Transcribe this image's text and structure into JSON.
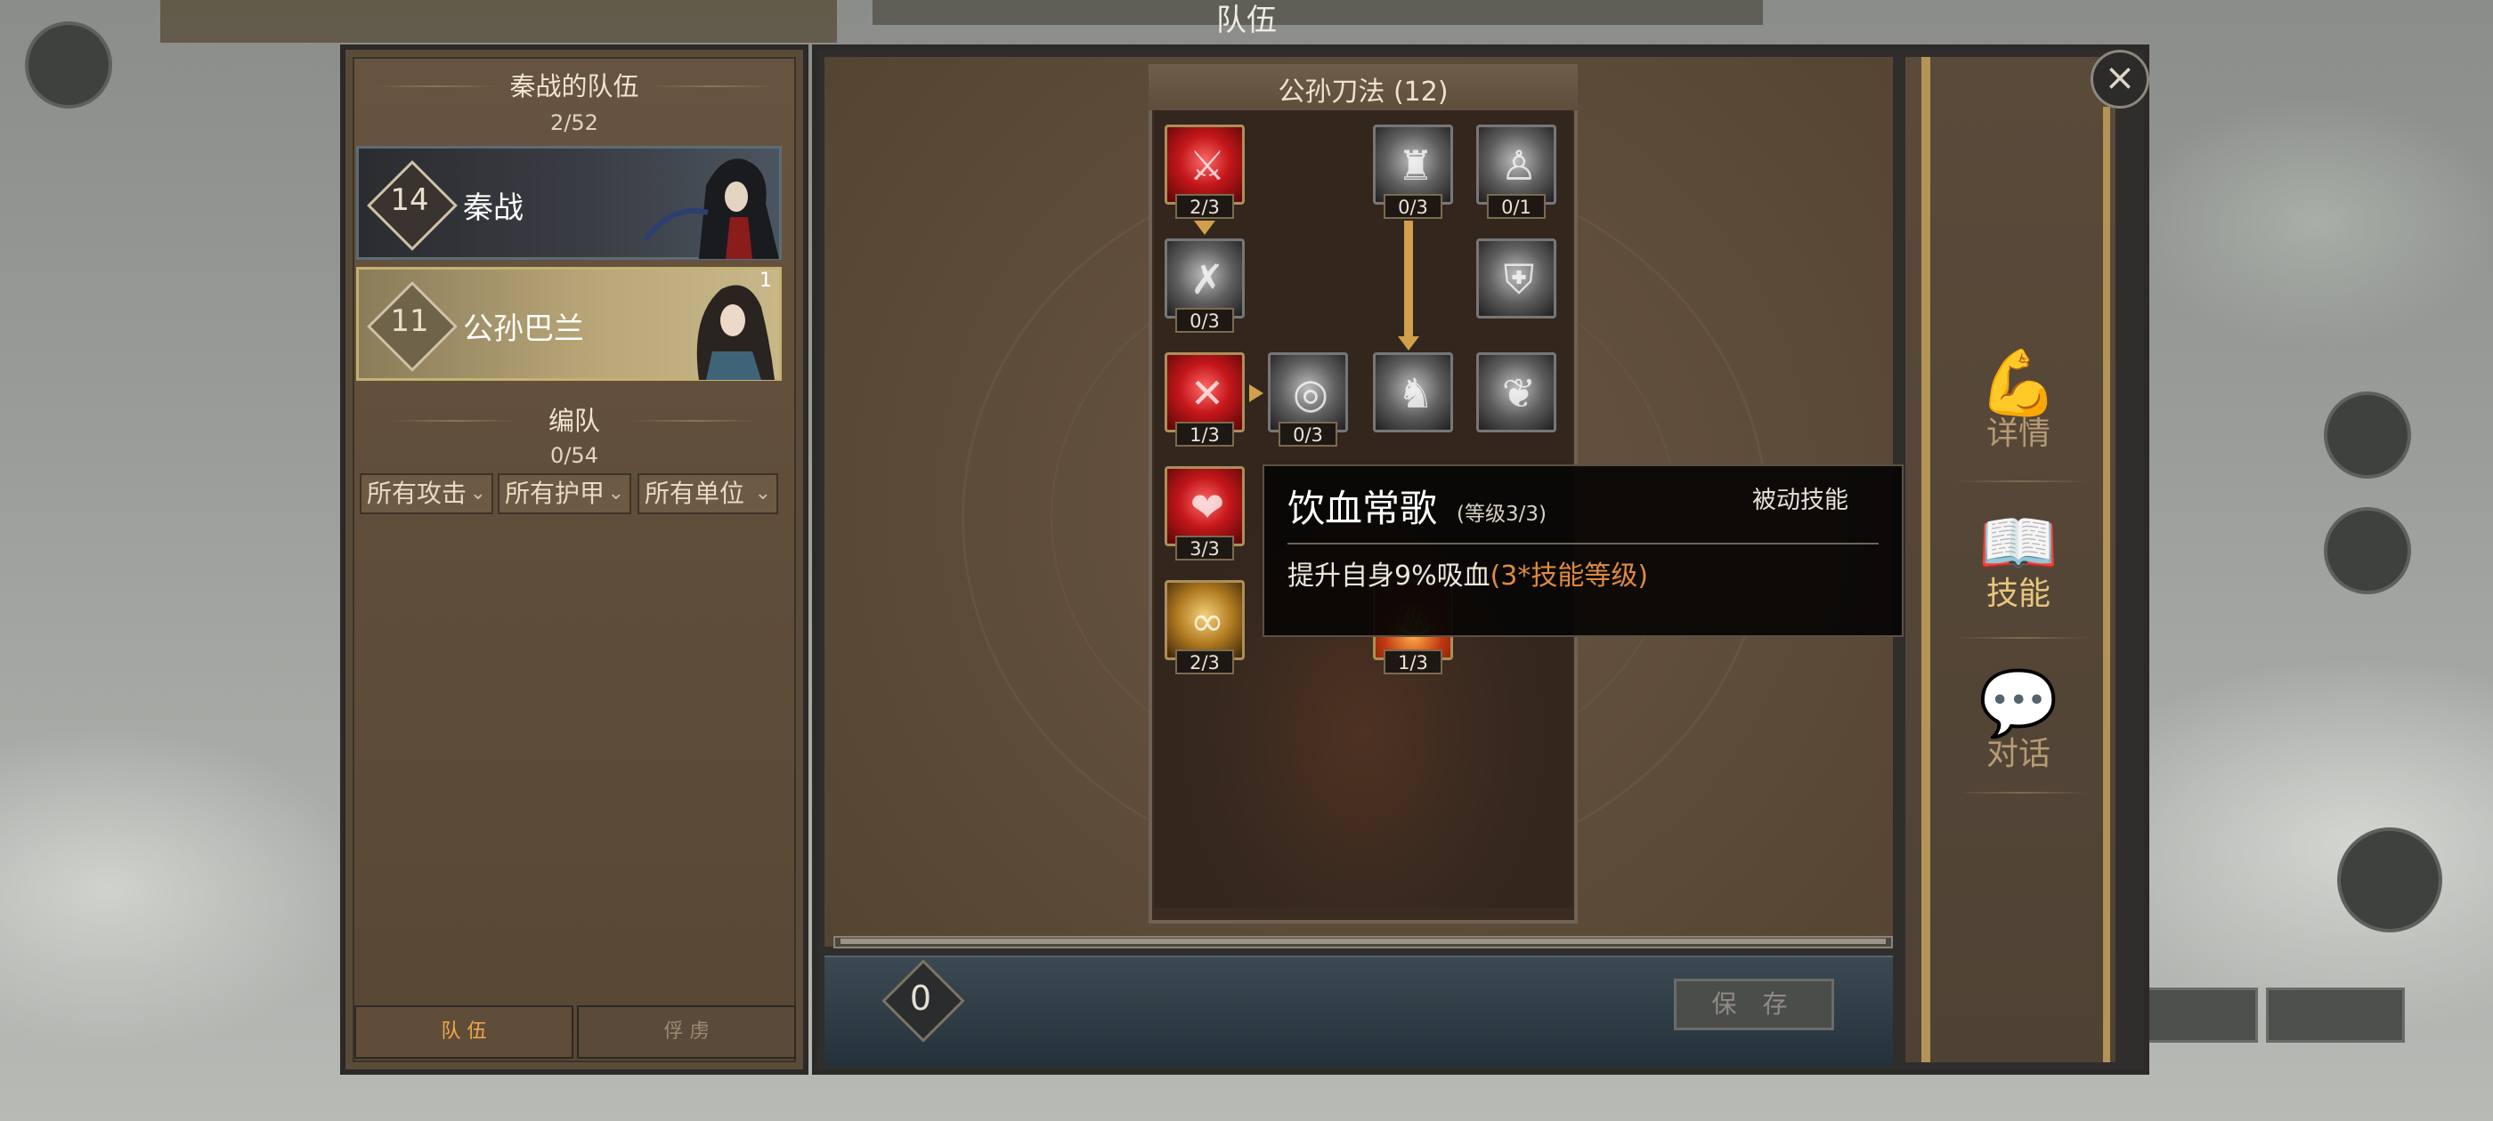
{
  "window_title": "队伍",
  "team_panel": {
    "title": "秦战的队伍",
    "count": "2/52",
    "members": [
      {
        "level": "14",
        "name": "秦战"
      },
      {
        "level": "11",
        "name": "公孙巴兰",
        "badge": "1"
      }
    ],
    "formation_title": "编队",
    "formation_count": "0/54",
    "filters": [
      "所有攻击",
      "所有护甲",
      "所有单位"
    ]
  },
  "bottom_tabs": [
    "队 伍",
    "俘 虏"
  ],
  "skill_tree": {
    "title": "公孙刀法 (12)",
    "skills": [
      {
        "level": "2/3",
        "style": "red"
      },
      {
        "level": "0/3",
        "style": "gray"
      },
      {
        "level": "0/1",
        "style": "gray"
      },
      {
        "level": "0/3",
        "style": "gray"
      },
      {
        "level": "",
        "style": "gray"
      },
      {
        "level": "1/3",
        "style": "red"
      },
      {
        "level": "0/3",
        "style": "gray"
      },
      {
        "level": "",
        "style": "gray"
      },
      {
        "level": "",
        "style": "gray"
      },
      {
        "level": "3/3",
        "style": "red"
      },
      {
        "level": "2/3",
        "style": "gold"
      },
      {
        "level": "1/3",
        "style": "red"
      }
    ]
  },
  "tooltip": {
    "name": "饮血常歌",
    "level": "(等级3/3)",
    "type": "被动技能",
    "desc_prefix": "提升自身9%吸血",
    "desc_highlight": "(3*技能等级)"
  },
  "skill_points": "0",
  "save_label": "保 存",
  "side_tabs": [
    {
      "label": "详情",
      "icon": "flexed-arm-icon"
    },
    {
      "label": "技能",
      "icon": "flame-book-icon"
    },
    {
      "label": "对话",
      "icon": "speech-bubble-icon"
    }
  ],
  "colors": {
    "accent_gold": "#d2a04c",
    "highlight_orange": "#e08a3d",
    "active_tab": "#f0a94a"
  }
}
